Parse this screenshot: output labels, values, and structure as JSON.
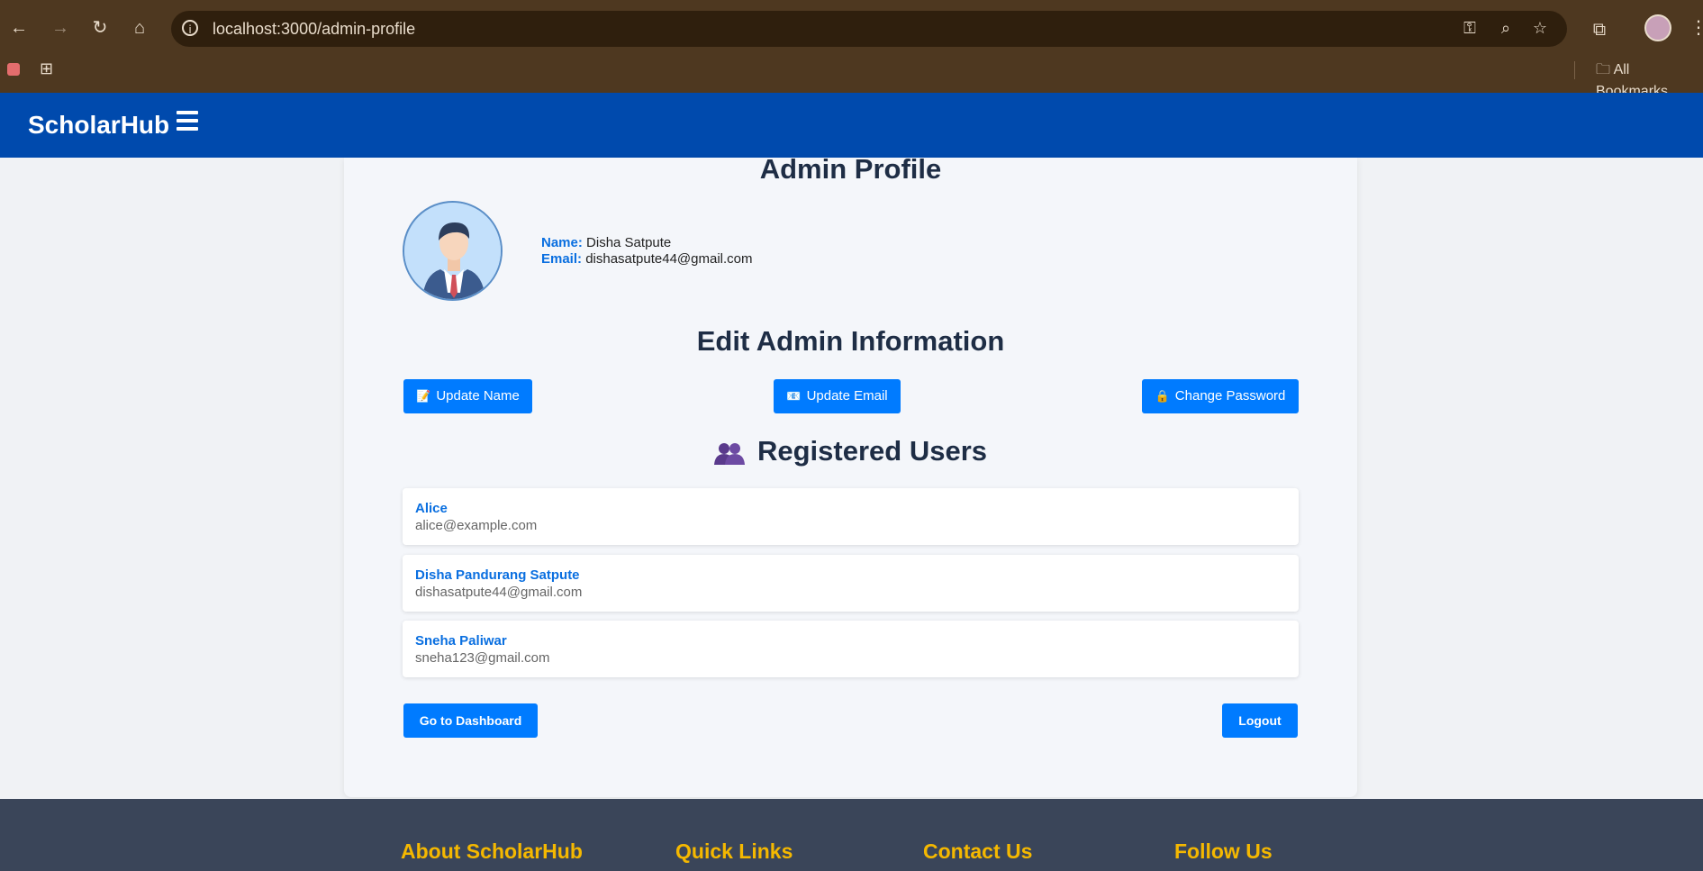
{
  "browser": {
    "url": "localhost:3000/admin-profile",
    "bookmarks_label": "All Bookmarks"
  },
  "app": {
    "brand": "ScholarHub"
  },
  "profile": {
    "title": "Admin Profile",
    "name_label": "Name:",
    "name_value": "Disha Satpute",
    "email_label": "Email:",
    "email_value": "dishasatpute44@gmail.com"
  },
  "edit": {
    "title": "Edit Admin Information",
    "update_name": "Update Name",
    "update_email": "Update Email",
    "change_password": "Change Password"
  },
  "registered": {
    "title": "Registered Users",
    "users": [
      {
        "name": "Alice",
        "email": "alice@example.com"
      },
      {
        "name": "Disha Pandurang Satpute",
        "email": "dishasatpute44@gmail.com"
      },
      {
        "name": "Sneha Paliwar",
        "email": "sneha123@gmail.com"
      }
    ]
  },
  "actions": {
    "dashboard": "Go to Dashboard",
    "logout": "Logout"
  },
  "footer": {
    "about": "About ScholarHub",
    "links": "Quick Links",
    "contact": "Contact Us",
    "follow": "Follow Us"
  },
  "colors": {
    "appbar": "#004aad",
    "primary_button": "#007bff",
    "footer_heading": "#f5b800"
  }
}
